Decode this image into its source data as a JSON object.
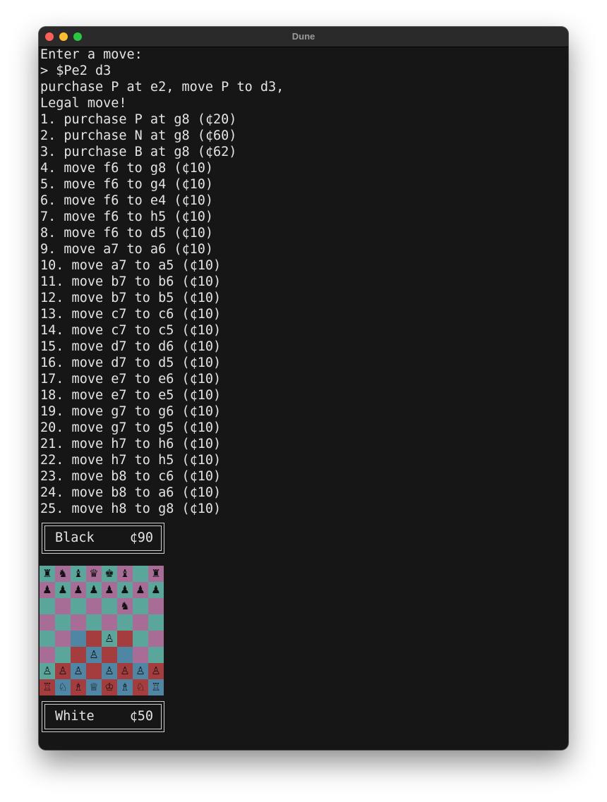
{
  "window": {
    "title": "Dune"
  },
  "terminal": {
    "lines": [
      "Enter a move:",
      "> $Pe2 d3",
      "purchase P at e2, move P to d3,",
      "Legal move!",
      "1. purchase P at g8 (¢20)",
      "2. purchase N at g8 (¢60)",
      "3. purchase B at g8 (¢62)",
      "4. move f6 to g8 (¢10)",
      "5. move f6 to g4 (¢10)",
      "6. move f6 to e4 (¢10)",
      "7. move f6 to h5 (¢10)",
      "8. move f6 to d5 (¢10)",
      "9. move a7 to a6 (¢10)",
      "10. move a7 to a5 (¢10)",
      "11. move b7 to b6 (¢10)",
      "12. move b7 to b5 (¢10)",
      "13. move c7 to c6 (¢10)",
      "14. move c7 to c5 (¢10)",
      "15. move d7 to d6 (¢10)",
      "16. move d7 to d5 (¢10)",
      "17. move e7 to e6 (¢10)",
      "18. move e7 to e5 (¢10)",
      "19. move g7 to g6 (¢10)",
      "20. move g7 to g5 (¢10)",
      "21. move h7 to h6 (¢10)",
      "22. move h7 to h5 (¢10)",
      "23. move b8 to c6 (¢10)",
      "24. move b8 to a6 (¢10)",
      "25. move h8 to g8 (¢10)"
    ]
  },
  "black_panel": {
    "name": "Black",
    "money": "¢90"
  },
  "white_panel": {
    "name": "White",
    "money": "¢50"
  },
  "board": {
    "colors": {
      "light": "#a76d97",
      "dark": "#5ba69b",
      "white_control": "#a53d3f",
      "contested": "#4f86a4"
    },
    "rows": [
      [
        {
          "p": "♜",
          "c": "dark"
        },
        {
          "p": "♞",
          "c": "light"
        },
        {
          "p": "♝",
          "c": "dark"
        },
        {
          "p": "♛",
          "c": "light"
        },
        {
          "p": "♚",
          "c": "dark"
        },
        {
          "p": "♝",
          "c": "light"
        },
        {
          "p": "",
          "c": "dark"
        },
        {
          "p": "♜",
          "c": "light"
        }
      ],
      [
        {
          "p": "♟",
          "c": "light"
        },
        {
          "p": "♟",
          "c": "dark"
        },
        {
          "p": "♟",
          "c": "light"
        },
        {
          "p": "♟",
          "c": "dark"
        },
        {
          "p": "♟",
          "c": "light"
        },
        {
          "p": "♟",
          "c": "dark"
        },
        {
          "p": "♟",
          "c": "light"
        },
        {
          "p": "♟",
          "c": "dark"
        }
      ],
      [
        {
          "p": "",
          "c": "dark"
        },
        {
          "p": "",
          "c": "light"
        },
        {
          "p": "",
          "c": "dark"
        },
        {
          "p": "",
          "c": "light"
        },
        {
          "p": "",
          "c": "dark"
        },
        {
          "p": "♞",
          "c": "light"
        },
        {
          "p": "",
          "c": "dark"
        },
        {
          "p": "",
          "c": "light"
        }
      ],
      [
        {
          "p": "",
          "c": "light"
        },
        {
          "p": "",
          "c": "dark"
        },
        {
          "p": "",
          "c": "light"
        },
        {
          "p": "",
          "c": "dark"
        },
        {
          "p": "",
          "c": "light"
        },
        {
          "p": "",
          "c": "dark"
        },
        {
          "p": "",
          "c": "light"
        },
        {
          "p": "",
          "c": "dark"
        }
      ],
      [
        {
          "p": "",
          "c": "dark"
        },
        {
          "p": "",
          "c": "light"
        },
        {
          "p": "",
          "c": "contested"
        },
        {
          "p": "",
          "c": "white_control"
        },
        {
          "p": "♙",
          "c": "dark"
        },
        {
          "p": "",
          "c": "white_control"
        },
        {
          "p": "",
          "c": "dark"
        },
        {
          "p": "",
          "c": "light"
        }
      ],
      [
        {
          "p": "",
          "c": "light"
        },
        {
          "p": "",
          "c": "dark"
        },
        {
          "p": "",
          "c": "white_control"
        },
        {
          "p": "♙",
          "c": "contested"
        },
        {
          "p": "",
          "c": "white_control"
        },
        {
          "p": "",
          "c": "contested"
        },
        {
          "p": "",
          "c": "light"
        },
        {
          "p": "",
          "c": "dark"
        }
      ],
      [
        {
          "p": "♙",
          "c": "dark"
        },
        {
          "p": "♙",
          "c": "white_control"
        },
        {
          "p": "♙",
          "c": "contested"
        },
        {
          "p": "",
          "c": "white_control"
        },
        {
          "p": "♙",
          "c": "contested"
        },
        {
          "p": "♙",
          "c": "white_control"
        },
        {
          "p": "♙",
          "c": "contested"
        },
        {
          "p": "♙",
          "c": "white_control"
        }
      ],
      [
        {
          "p": "♖",
          "c": "white_control"
        },
        {
          "p": "♘",
          "c": "contested"
        },
        {
          "p": "♗",
          "c": "white_control"
        },
        {
          "p": "♕",
          "c": "contested"
        },
        {
          "p": "♔",
          "c": "white_control"
        },
        {
          "p": "♗",
          "c": "contested"
        },
        {
          "p": "♘",
          "c": "white_control"
        },
        {
          "p": "♖",
          "c": "contested"
        }
      ]
    ]
  }
}
